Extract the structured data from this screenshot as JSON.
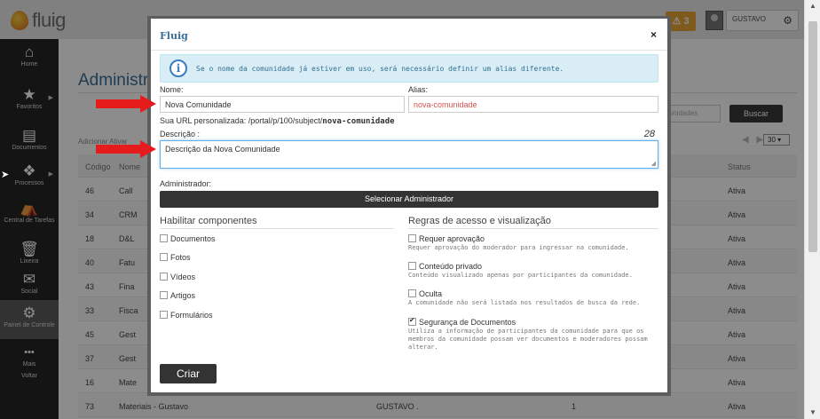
{
  "app": {
    "logo_text": "fluig",
    "notification_count": "3",
    "user_name": "GUSTAVO"
  },
  "sidebar": {
    "items": [
      {
        "label": "Home",
        "icon": "home-icon",
        "glyph": "⌂"
      },
      {
        "label": "Favoritos",
        "icon": "star-icon",
        "glyph": "★"
      },
      {
        "label": "Documentos",
        "icon": "document-icon",
        "glyph": "▤"
      },
      {
        "label": "Processos",
        "icon": "process-icon",
        "glyph": "❖"
      },
      {
        "label": "Central de Tarefas",
        "icon": "tasks-icon",
        "glyph": "⛺"
      },
      {
        "label": "Lixeira",
        "icon": "trash-icon",
        "glyph": "🗑"
      },
      {
        "label": "Social",
        "icon": "chat-icon",
        "glyph": "✉"
      },
      {
        "label": "Painel de Controle",
        "icon": "gear-icon",
        "glyph": "⚙"
      },
      {
        "label": "Mais",
        "icon": "more-icon",
        "glyph": "•••"
      },
      {
        "label": "Voltar",
        "icon": "back-icon",
        "glyph": ""
      }
    ]
  },
  "page": {
    "title": "Administrar",
    "search_placeholder": "munidades",
    "search_button": "Buscar",
    "toolbar_text": "Adicionar  Ativar",
    "pager": "◀ ▶",
    "page_size": "30 ▾",
    "table": {
      "headers": [
        "Código",
        "Nome",
        "",
        "",
        "Status"
      ],
      "rows": [
        [
          "46",
          "Call",
          "",
          "",
          "Ativa"
        ],
        [
          "34",
          "CRM",
          "",
          "",
          "Ativa"
        ],
        [
          "18",
          "D&L",
          "",
          "",
          "Ativa"
        ],
        [
          "40",
          "Fatu",
          "",
          "",
          "Ativa"
        ],
        [
          "43",
          "Fina",
          "",
          "",
          "Ativa"
        ],
        [
          "33",
          "Fisca",
          "",
          "",
          "Ativa"
        ],
        [
          "45",
          "Gest",
          "",
          "",
          "Ativa"
        ],
        [
          "37",
          "Gest",
          "",
          "",
          "Ativa"
        ],
        [
          "16",
          "Mate",
          "",
          "",
          "Ativa"
        ],
        [
          "73",
          "Materiais - Gustavo",
          "GUSTAVO .",
          "1",
          "Ativa"
        ]
      ]
    }
  },
  "modal": {
    "title": "Fluig",
    "close": "×",
    "info_text": "Se o nome da comunidade já estiver em uso, será necessário definir um alias diferente.",
    "name_label": "Nome:",
    "name_value": "Nova Comunidade",
    "alias_label": "Alias:",
    "alias_value": "nova-comunidade",
    "url_prefix": "Sua URL personalizada: /portal/p/100/subject/",
    "url_slug": "nova-comunidade",
    "desc_label": "Descrição :",
    "desc_count": "28",
    "desc_value": "Descrição da Nova Comunidade",
    "admin_label": "Administrador:",
    "admin_button": "Selecionar Administrador",
    "components_title": "Habilitar componentes",
    "components": [
      {
        "label": "Documentos",
        "checked": false
      },
      {
        "label": "Fotos",
        "checked": false
      },
      {
        "label": "Vídeos",
        "checked": false
      },
      {
        "label": "Artigos",
        "checked": false
      },
      {
        "label": "Formulários",
        "checked": false
      }
    ],
    "rules_title": "Regras de acesso e visualização",
    "rules": [
      {
        "label": "Requer aprovação",
        "help": "Requer aprovação do moderador para ingressar na comunidade.",
        "checked": false
      },
      {
        "label": "Conteúdo privado",
        "help": "Conteúdo visualizado apenas por participantes da comunidade.",
        "checked": false
      },
      {
        "label": "Oculta",
        "help": "A comunidade não será listada nos resultados de busca da rede.",
        "checked": false
      },
      {
        "label": "Segurança de Documentos",
        "help": "Utiliza a informação de participantes da comunidade para que os membros da comunidade possam ver documentos e moderadores possam alterar.",
        "checked": true
      }
    ],
    "create_button": "Criar"
  },
  "colors": {
    "accent": "#3a6f9a",
    "arrow": "#e51c1c",
    "info_bg": "#d9edf7",
    "alias_text": "#d9534f"
  }
}
